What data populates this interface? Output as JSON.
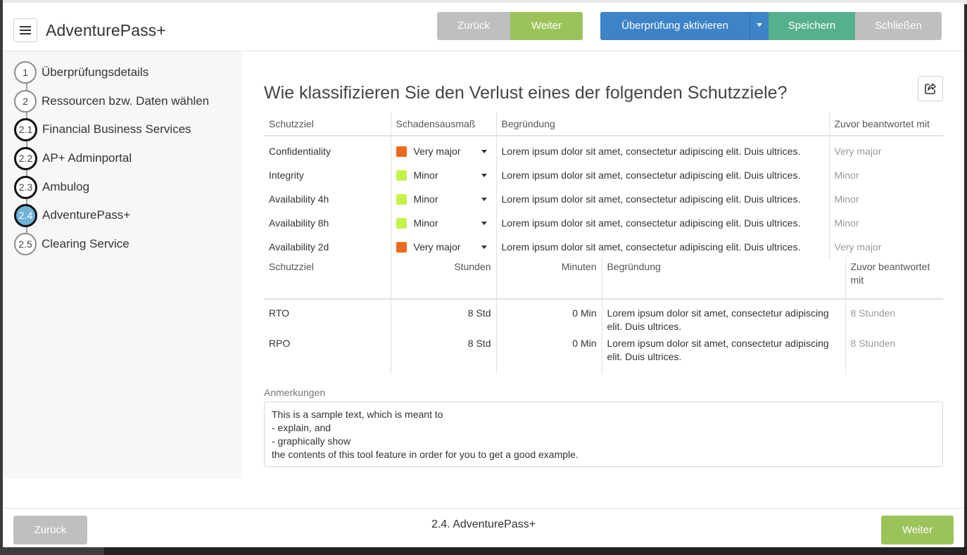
{
  "header": {
    "title": "AdventurePass+",
    "buttons": {
      "back": "Zurück",
      "next": "Weiter",
      "activate_review": "Überprüfung aktivieren",
      "save": "Speichern",
      "close": "Schließen"
    }
  },
  "sidebar": {
    "steps": [
      {
        "num": "1",
        "label": "Überprüfungsdetails",
        "state": "normal"
      },
      {
        "num": "2",
        "label": "Ressourcen bzw. Daten wählen",
        "state": "normal"
      },
      {
        "num": "2.1",
        "label": "Financial Business Services",
        "state": "done"
      },
      {
        "num": "2.2",
        "label": "AP+ Adminportal",
        "state": "done"
      },
      {
        "num": "2.3",
        "label": "Ambulog",
        "state": "done"
      },
      {
        "num": "2.4",
        "label": "AdventurePass+",
        "state": "active"
      },
      {
        "num": "2.5",
        "label": "Clearing Service",
        "state": "normal"
      }
    ]
  },
  "main": {
    "question": "Wie klassifizieren Sie den Verlust eines der folgenden Schutzziele?",
    "impact_table": {
      "headers": [
        "Schutzziel",
        "Schadensausmaß",
        "Begründung",
        "Zuvor beantwortet mit"
      ],
      "rows": [
        {
          "goal": "Confidentiality",
          "impact": "Very major",
          "color": "#ec6a1f",
          "reason": "Lorem ipsum dolor sit amet, consectetur adipiscing elit. Duis ultrices.",
          "previous": "Very major"
        },
        {
          "goal": "Integrity",
          "impact": "Minor",
          "color": "#c4f24a",
          "reason": "Lorem ipsum dolor sit amet, consectetur adipiscing elit. Duis ultrices.",
          "previous": "Minor"
        },
        {
          "goal": "Availability 4h",
          "impact": "Minor",
          "color": "#c4f24a",
          "reason": "Lorem ipsum dolor sit amet, consectetur adipiscing elit. Duis ultrices.",
          "previous": "Minor"
        },
        {
          "goal": "Availability 8h",
          "impact": "Minor",
          "color": "#c4f24a",
          "reason": "Lorem ipsum dolor sit amet, consectetur adipiscing elit. Duis ultrices.",
          "previous": "Minor"
        },
        {
          "goal": "Availability 2d",
          "impact": "Very major",
          "color": "#ec6a1f",
          "reason": "Lorem ipsum dolor sit amet, consectetur adipiscing elit. Duis ultrices.",
          "previous": "Very major"
        }
      ]
    },
    "time_table": {
      "headers": [
        "Schutzziel",
        "Stunden",
        "Minuten",
        "Begründung",
        "Zuvor beantwortet mit"
      ],
      "rows": [
        {
          "goal": "RTO",
          "hours": "8 Std",
          "minutes": "0 Min",
          "reason": "Lorem ipsum dolor sit amet, consectetur adipiscing elit. Duis ultrices.",
          "previous": "8 Stunden"
        },
        {
          "goal": "RPO",
          "hours": "8 Std",
          "minutes": "0 Min",
          "reason": "Lorem ipsum dolor sit amet, consectetur adipiscing elit. Duis ultrices.",
          "previous": "8 Stunden"
        }
      ]
    },
    "notes": {
      "label": "Anmerkungen",
      "value": "This is a sample text, which is meant to\n- explain, and\n- graphically show\nthe contents of this tool feature in order for you to get a good example."
    }
  },
  "footer": {
    "back": "Zurück",
    "title": "2.4. AdventurePass+",
    "next": "Weiter"
  },
  "icons": {
    "menu": "hamburger-menu-icon",
    "share": "share-icon",
    "dropdown": "caret-down-icon"
  }
}
